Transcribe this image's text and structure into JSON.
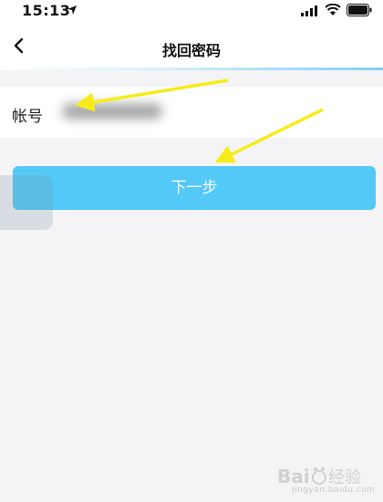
{
  "status_bar": {
    "time": "15:13",
    "icons": [
      "location-arrow-icon",
      "signal-icon",
      "wifi-icon",
      "battery-icon"
    ]
  },
  "nav": {
    "back_icon": "chevron-left-icon",
    "title": "找回密码"
  },
  "form": {
    "account_label": "帐号",
    "account_value": "",
    "account_placeholder": ""
  },
  "actions": {
    "next_label": "下一步"
  },
  "watermark": {
    "text": "Baidu 经验",
    "caption": "jingyan.baidu.com"
  },
  "colors": {
    "background": "#f4f4f6",
    "button": "#54c9f8",
    "button_text": "#ffffff",
    "annotation_arrow": "#f5ec1a",
    "header_accent": "#7fd0f3"
  }
}
